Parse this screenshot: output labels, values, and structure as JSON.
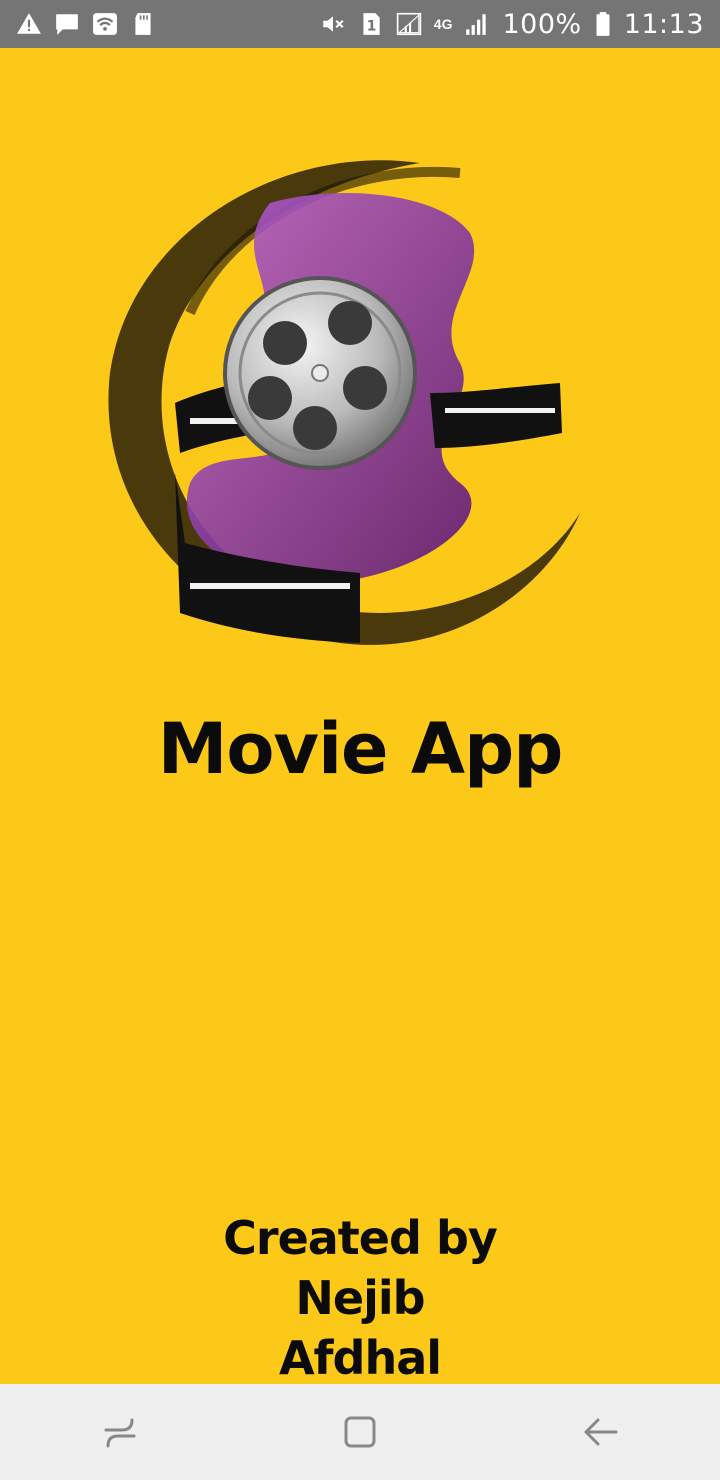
{
  "status_bar": {
    "battery": "100%",
    "time": "11:13",
    "network": "4G",
    "sim_slot": "1",
    "icons": [
      "warning-icon",
      "message-icon",
      "wifi-icon",
      "sd-card-icon",
      "mute-icon",
      "sim-icon",
      "signal-icon",
      "battery-icon"
    ]
  },
  "app": {
    "title": "Movie App",
    "credit_line1": "Created by Nejib",
    "credit_line2": "Afdhal",
    "background_color": "#FDC918"
  },
  "nav_bar": {
    "icons": [
      "recent-apps-icon",
      "home-icon",
      "back-icon"
    ]
  }
}
